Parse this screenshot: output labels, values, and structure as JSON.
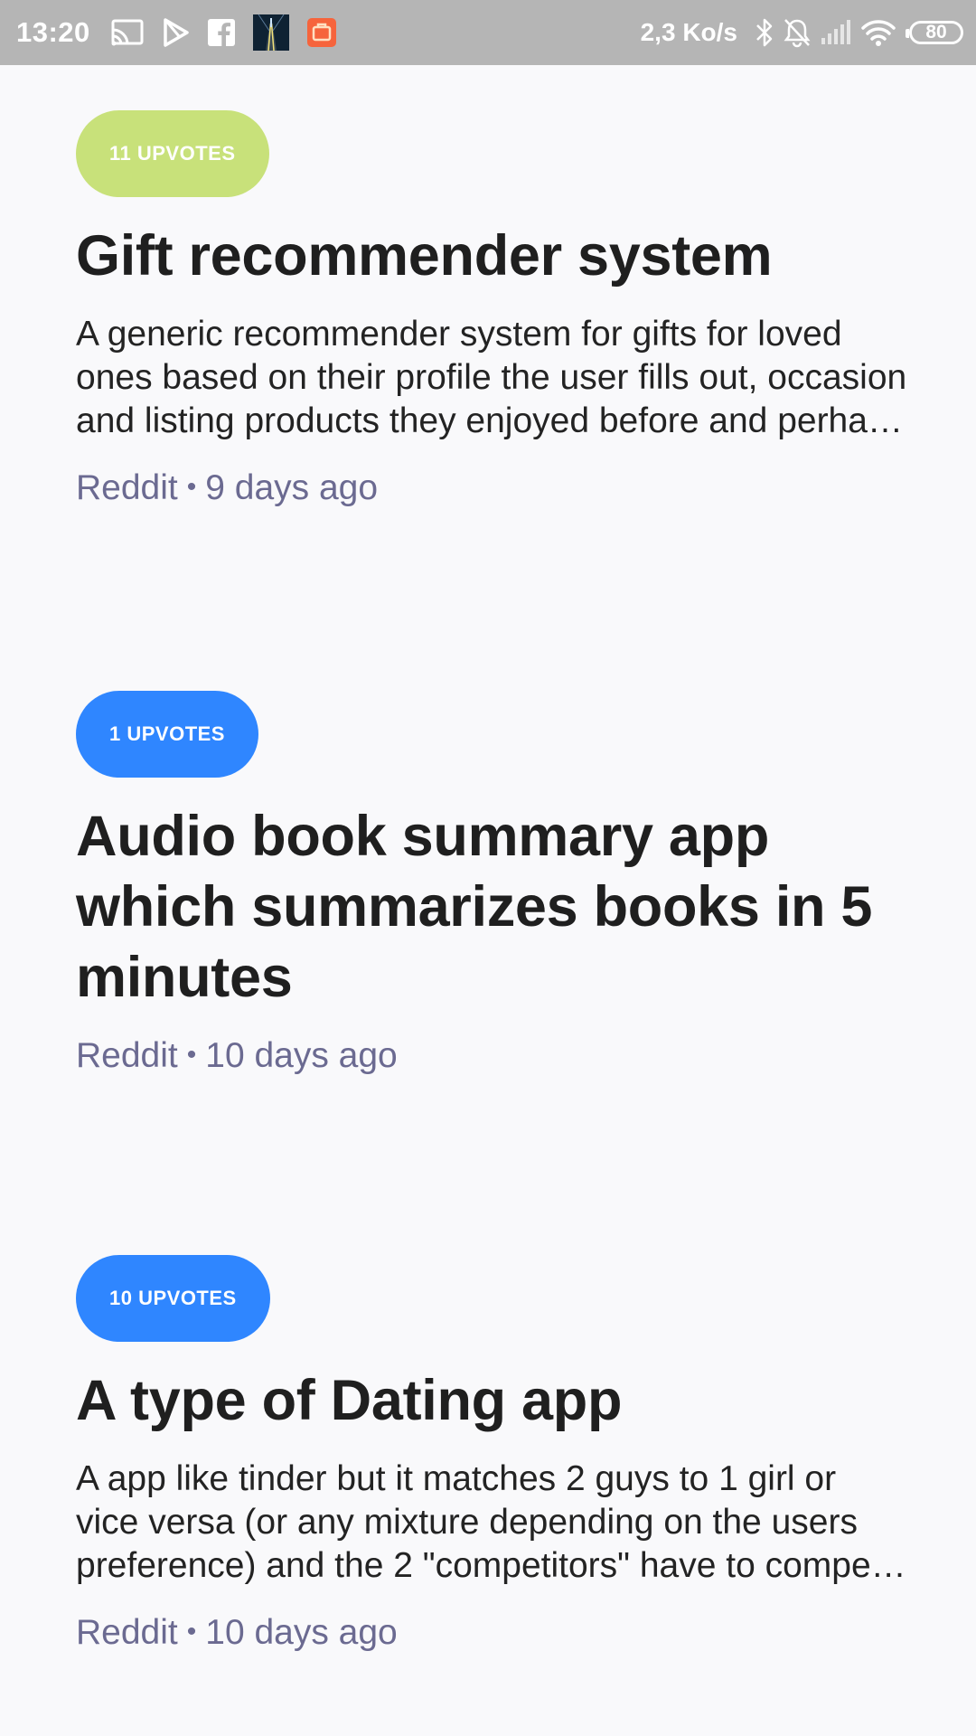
{
  "status_bar": {
    "time": "13:20",
    "net_speed": "2,3 Ko/s",
    "battery": "80",
    "icons_left": [
      "cast-icon",
      "play-store-icon",
      "facebook-icon",
      "road-app-icon",
      "orange-app-icon"
    ],
    "icons_right": [
      "bluetooth-icon",
      "bell-off-icon",
      "signal-icon",
      "wifi-icon",
      "battery-icon"
    ],
    "color": "#b5b5b5"
  },
  "colors": {
    "badge_green": "#c8e17a",
    "badge_blue": "#2f86ff",
    "meta": "#6b6a91",
    "title": "#1f1f1f",
    "background": "#f9f9fb"
  },
  "posts": [
    {
      "upvotes": "11 UPVOTES",
      "badge_color": "green",
      "title": "Gift recommender system",
      "description": "A generic recommender system for gifts for loved ones based on their profile the user fills out, occasion and listing products they enjoyed before and perhaps the products they have been browsing lately.",
      "source": "Reddit",
      "separator": "•",
      "time_ago": "9 days ago"
    },
    {
      "upvotes": "1 UPVOTES",
      "badge_color": "blue",
      "title": "Audio book summary app which summarizes books in 5 minutes",
      "description": "",
      "source": "Reddit",
      "separator": "•",
      "time_ago": "10 days ago"
    },
    {
      "upvotes": "10 UPVOTES",
      "badge_color": "blue",
      "title": "A type of Dating app",
      "description": "A app like tinder but it matches 2 guys to 1 girl or vice versa (or any mixture depending on the users preference) and the 2 \"competitors\" have to compete for the attention of the third person.",
      "source": "Reddit",
      "separator": "•",
      "time_ago": "10 days ago"
    }
  ]
}
